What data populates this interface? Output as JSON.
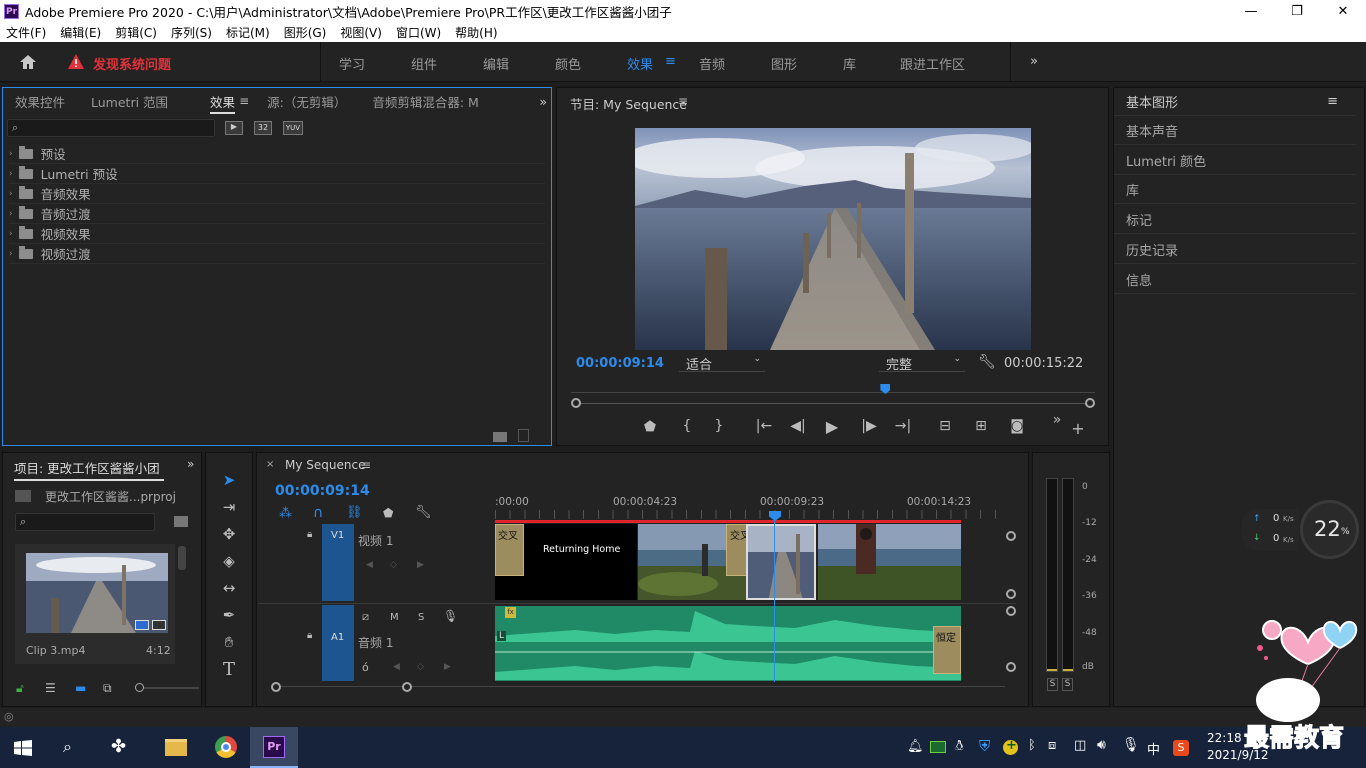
{
  "window": {
    "title": "Adobe Premiere Pro 2020 - C:\\用户\\Administrator\\文档\\Adobe\\Premiere Pro\\PR工作区\\更改工作区酱酱小团子",
    "app_icon": "Pr"
  },
  "menu": [
    "文件(F)",
    "编辑(E)",
    "剪辑(C)",
    "序列(S)",
    "标记(M)",
    "图形(G)",
    "视图(V)",
    "窗口(W)",
    "帮助(H)"
  ],
  "workspace": {
    "alert": "发现系统问题",
    "tabs": [
      "学习",
      "组件",
      "编辑",
      "颜色",
      "效果",
      "音频",
      "图形",
      "库",
      "跟进工作区"
    ],
    "active": "效果"
  },
  "effects_panel": {
    "tabs": [
      "效果控件",
      "Lumetri 范围",
      "效果",
      "源:（无剪辑）",
      "音频剪辑混合器: M"
    ],
    "badges": [
      "32",
      "YUV"
    ],
    "items": [
      "预设",
      "Lumetri 预设",
      "音频效果",
      "音频过渡",
      "视频效果",
      "视频过渡"
    ]
  },
  "program_monitor": {
    "title": "节目: My Sequence",
    "timecode_current": "00:00:09:14",
    "fit": "适合",
    "quality": "完整",
    "timecode_duration": "00:00:15:22",
    "playhead_fraction": 0.6
  },
  "right_panels": [
    "基本图形",
    "基本声音",
    "Lumetri 颜色",
    "库",
    "标记",
    "历史记录",
    "信息"
  ],
  "project_panel": {
    "title": "项目: 更改工作区酱酱小团",
    "file": "更改工作区酱酱...prproj",
    "clip_name": "Clip 3.mp4",
    "clip_duration": "4:12"
  },
  "timeline": {
    "sequence": "My Sequence",
    "timecode": "00:00:09:14",
    "ruler": [
      ":00:00",
      "00:00:04:23",
      "00:00:09:23",
      "00:00:14:23"
    ],
    "v1": {
      "name": "V1",
      "label": "视频 1"
    },
    "a1": {
      "name": "A1",
      "label": "音频 1",
      "buttons": [
        "M",
        "S"
      ]
    },
    "clips": {
      "transition1": "交叉",
      "title_clip": "Returning Home",
      "transition2": "交叉溶",
      "audio_transition": "恒定",
      "fx": "fx",
      "l": "L"
    }
  },
  "meter": {
    "scale": [
      "0",
      "-12",
      "-24",
      "-36",
      "-48",
      "dB"
    ],
    "solo": [
      "S",
      "S"
    ]
  },
  "network_widget": {
    "up": "0",
    "down": "0",
    "unit": "K/s",
    "percent": "22",
    "percent_sign": "%"
  },
  "taskbar": {
    "time": "22:18",
    "date": "2021/9/12",
    "ime": "中"
  },
  "watermark": "最需教育"
}
